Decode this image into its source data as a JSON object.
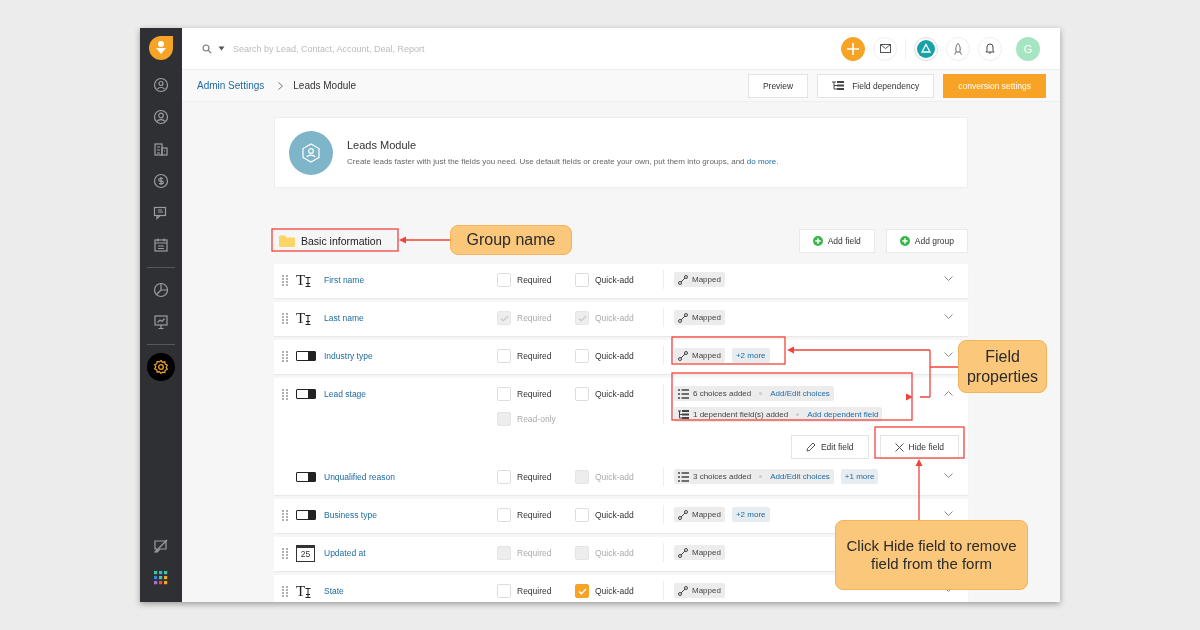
{
  "sidebar": {
    "items": [
      {
        "kind": "lead",
        "selected": false
      },
      {
        "kind": "contact",
        "selected": false
      },
      {
        "kind": "accounts",
        "selected": false
      },
      {
        "kind": "deals",
        "selected": false
      },
      {
        "kind": "chat",
        "selected": false
      },
      {
        "kind": "calendar",
        "selected": false
      },
      {
        "kind": "reports",
        "selected": false
      },
      {
        "kind": "presentation",
        "selected": false
      },
      {
        "kind": "settings",
        "selected": true
      }
    ],
    "bottom_items": [
      {
        "kind": "chat-off"
      },
      {
        "kind": "apps"
      }
    ]
  },
  "top_bar": {
    "search": {
      "placeholder": "Search by Lead, Contact, Account, Deal, Report"
    },
    "avatar": "G"
  },
  "breadcrumb": [
    "Admin Settings",
    "Leads Module"
  ],
  "actions": [
    {
      "label": "Preview",
      "kind": "plain"
    },
    {
      "label": "Field dependency",
      "kind": "dependency"
    },
    {
      "label": "conversion settings",
      "kind": "primary"
    }
  ],
  "module": {
    "title": "Leads Module",
    "description": "Create leads faster with just the fields you need. Use default fields or create your own, put them into groups, and",
    "link": "do more."
  },
  "group": {
    "name": "Basic information",
    "buttons": [
      "Add field",
      "Add group"
    ]
  },
  "fields": [
    {
      "kind": "text",
      "icon_label": "T",
      "name": "First name",
      "required": {
        "label": "Required",
        "checked": false,
        "disabled": false
      },
      "quick_add": {
        "label": "Quick-add",
        "checked": false,
        "disabled": false
      },
      "properties": [
        {
          "kind": "mapped",
          "text": "Mapped"
        }
      ],
      "expanded": false
    },
    {
      "kind": "text",
      "icon_label": "T",
      "name": "Last name",
      "required": {
        "label": "Required",
        "checked": true,
        "disabled": true
      },
      "quick_add": {
        "label": "Quick-add",
        "checked": true,
        "disabled": true
      },
      "properties": [
        {
          "kind": "mapped",
          "text": "Mapped"
        }
      ],
      "expanded": false
    },
    {
      "kind": "dropdown",
      "name": "Industry type",
      "required": {
        "label": "Required",
        "checked": false,
        "disabled": false
      },
      "quick_add": {
        "label": "Quick-add",
        "checked": false,
        "disabled": false
      },
      "properties": [
        {
          "kind": "mapped",
          "text": "Mapped"
        },
        {
          "kind": "more",
          "text": "+2 more"
        }
      ],
      "expanded": false
    },
    {
      "kind": "dropdown",
      "name": "Lead stage",
      "required": {
        "label": "Required",
        "checked": false,
        "disabled": false
      },
      "quick_add": {
        "label": "Quick-add",
        "checked": false,
        "disabled": false
      },
      "extra_options": [
        {
          "label": "Read-only",
          "checked": false,
          "disabled": true
        }
      ],
      "properties": [
        {
          "kind": "choices",
          "text": "6 choices added",
          "link": "Add/Edit choices"
        },
        {
          "kind": "dependent",
          "text": "1 dependent field(s) added",
          "link": "Add dependent field"
        }
      ],
      "expanded": true,
      "buttons": [
        {
          "label": "Edit field",
          "kind": "edit"
        },
        {
          "label": "Hide field",
          "kind": "hide"
        }
      ],
      "children": [
        {
          "kind": "dropdown",
          "name": "Unqualified reason",
          "required": {
            "label": "Required",
            "checked": false,
            "disabled": false
          },
          "quick_add": {
            "label": "Quick-add",
            "checked": false,
            "disabled": true
          },
          "properties": [
            {
              "kind": "choices",
              "text": "3 choices added",
              "link": "Add/Edit choices"
            },
            {
              "kind": "more",
              "text": "+1 more"
            }
          ],
          "expanded": false
        }
      ]
    },
    {
      "kind": "dropdown",
      "name": "Business type",
      "required": {
        "label": "Required",
        "checked": false,
        "disabled": false
      },
      "quick_add": {
        "label": "Quick-add",
        "checked": false,
        "disabled": false
      },
      "properties": [
        {
          "kind": "mapped",
          "text": "Mapped"
        },
        {
          "kind": "more",
          "text": "+2 more"
        }
      ],
      "expanded": false
    },
    {
      "kind": "date",
      "icon_label": "25",
      "name": "Updated at",
      "required": {
        "label": "Required",
        "checked": false,
        "disabled": true
      },
      "quick_add": {
        "label": "Quick-add",
        "checked": false,
        "disabled": true
      },
      "properties": [
        {
          "kind": "mapped",
          "text": "Mapped"
        }
      ],
      "expanded": false
    },
    {
      "kind": "text",
      "icon_label": "T",
      "name": "State",
      "required": {
        "label": "Required",
        "checked": false,
        "disabled": false
      },
      "quick_add": {
        "label": "Quick-add",
        "checked": true,
        "disabled": false
      },
      "properties": [
        {
          "kind": "mapped",
          "text": "Mapped"
        }
      ],
      "expanded": false
    }
  ],
  "annotations": [
    {
      "text": "Group name"
    },
    {
      "text": "Field properties"
    },
    {
      "text": "Click Hide field to remove field from the form"
    }
  ]
}
